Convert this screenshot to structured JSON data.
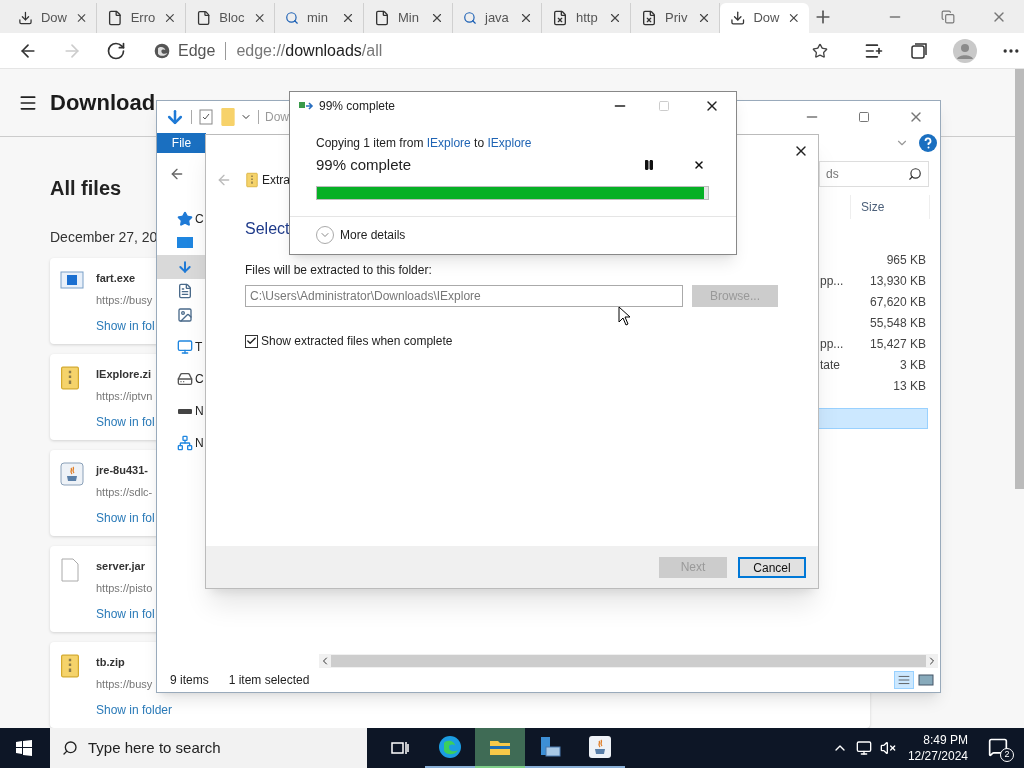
{
  "browser": {
    "tabs": [
      {
        "title": "Dow",
        "kind": "download",
        "selected": false
      },
      {
        "title": "Erro",
        "kind": "page",
        "selected": false
      },
      {
        "title": "Bloc",
        "kind": "page",
        "selected": false
      },
      {
        "title": "min",
        "kind": "search",
        "selected": false
      },
      {
        "title": "Min",
        "kind": "page",
        "selected": false
      },
      {
        "title": "java",
        "kind": "search",
        "selected": false
      },
      {
        "title": "http",
        "kind": "error",
        "selected": false
      },
      {
        "title": "Priv",
        "kind": "error",
        "selected": false
      },
      {
        "title": "Dow",
        "kind": "download",
        "selected": true
      }
    ],
    "site_label": "Edge",
    "url_prefix": "edge://",
    "url_main": "downloads",
    "url_suffix": "/all"
  },
  "downloads_page": {
    "title": "Download",
    "section": "All files",
    "date": "December 27, 20",
    "items": [
      {
        "name": "fart.exe",
        "url": "https://busy",
        "action": "Show in fol",
        "kind": "exe"
      },
      {
        "name": "IExplore.zi",
        "url": "https://iptvn",
        "action": "Show in fol",
        "kind": "zip"
      },
      {
        "name": "jre-8u431-",
        "url": "https://sdlc-",
        "action": "Show in fol",
        "kind": "java"
      },
      {
        "name": "server.jar",
        "url": "https://pisto",
        "action": "Show in fol",
        "kind": "file"
      },
      {
        "name": "tb.zip",
        "url": "https://busy",
        "action": "Show in folder",
        "kind": "zip"
      }
    ]
  },
  "explorer": {
    "title": "Dow",
    "ribbon_tab": "File",
    "search": "ds",
    "size_header": "Size",
    "nav_items": [
      {
        "label": "C",
        "kind": "star",
        "selected": false
      },
      {
        "kind": "desktop",
        "selected": false
      },
      {
        "kind": "download",
        "selected": true
      },
      {
        "kind": "document",
        "selected": false
      },
      {
        "kind": "pictures",
        "selected": false
      },
      {
        "label": "T",
        "kind": "pc",
        "selected": false
      },
      {
        "label": "C",
        "kind": "drive",
        "selected": false
      },
      {
        "label": "N",
        "kind": "network-drive",
        "selected": false
      },
      {
        "label": "N",
        "kind": "network",
        "selected": false
      }
    ],
    "rows": [
      {
        "size": "965 KB",
        "selected": false
      },
      {
        "type": "pp...",
        "size": "13,930 KB",
        "selected": false
      },
      {
        "size": "67,620 KB",
        "selected": false
      },
      {
        "size": "55,548 KB",
        "selected": false
      },
      {
        "type": "pp...",
        "size": "15,427 KB",
        "selected": false
      },
      {
        "type": "tate",
        "size": "3 KB",
        "selected": false
      },
      {
        "size": "13 KB",
        "selected": false
      },
      {
        "selected": true
      }
    ],
    "status_count": "9 items",
    "status_selection": "1 item selected"
  },
  "wizard": {
    "heading": "Extra",
    "subheading": "Select",
    "folder_label": "Files will be extracted to this folder:",
    "folder_path": "C:\\Users\\Administrator\\Downloads\\IExplore",
    "browse": {
      "label": "Browse...",
      "disabled": true
    },
    "show_files": {
      "label": "Show extracted files when complete",
      "checked": true
    },
    "buttons": [
      {
        "label": "Next",
        "disabled": true,
        "default": false
      },
      {
        "label": "Cancel",
        "disabled": false,
        "default": true
      }
    ]
  },
  "copy_dialog": {
    "title": "99% complete",
    "message": "Copying 1 item from",
    "source": "IExplore",
    "joiner": "to",
    "destination": "IExplore",
    "status": "99% complete",
    "level": 0.99,
    "details": "More details"
  },
  "taskbar": {
    "search_placeholder": "Type here to search",
    "apps": [
      {
        "kind": "task-view",
        "active": false
      },
      {
        "kind": "edge",
        "active": false
      },
      {
        "kind": "explorer",
        "active": true
      },
      {
        "kind": "server",
        "active": false
      },
      {
        "kind": "java",
        "active": false
      }
    ],
    "time": "8:49 PM",
    "date": "12/27/2024",
    "notifications": "2"
  }
}
